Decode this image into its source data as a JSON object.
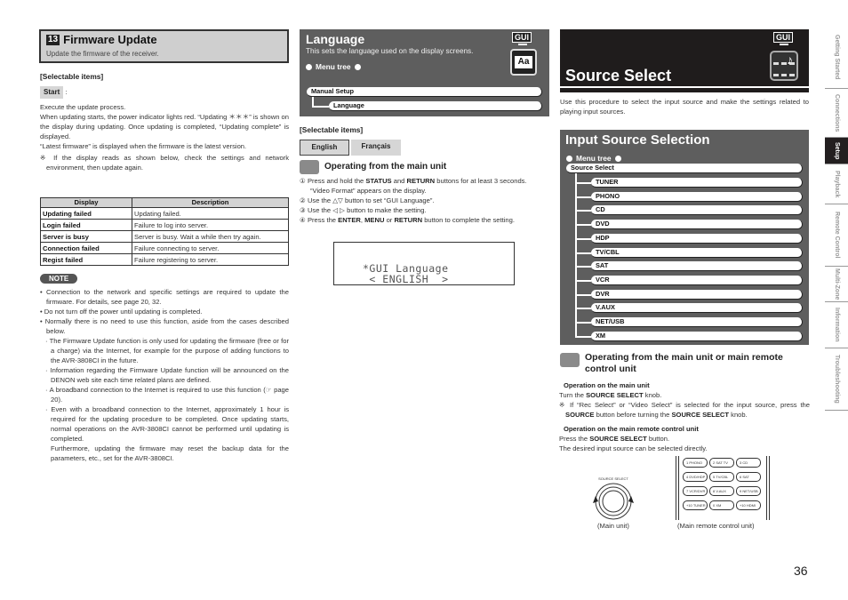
{
  "firmware_update": {
    "number": "13",
    "title": "Firmware Update",
    "subtitle": "Update the firmware of the receiver.",
    "selectable_label": "[Selectable items]",
    "start_chip": "Start",
    "start_colon": ":",
    "execute_text": "Execute the update process.",
    "para1": "When updating starts, the power indicator lights red. “Updating ＊＊＊” is shown on the display during updating. Once updating is completed, “Updating complete” is displayed.",
    "para2": "“Latest firmware” is displayed when the firmware is the latest version.",
    "note_mark": "※ If the display reads as shown below, check the settings and network environment, then update again.",
    "table": {
      "headers": [
        "Display",
        "Description"
      ],
      "rows": [
        [
          "Updating failed",
          "Updating failed."
        ],
        [
          "Login failed",
          "Failure to log into server."
        ],
        [
          "Server is busy",
          "Server is busy. Wait a while then try again."
        ],
        [
          "Connection failed",
          "Failure connecting to server."
        ],
        [
          "Regist failed",
          "Failure registering to server."
        ]
      ]
    },
    "note_label": "NOTE",
    "notes": [
      "• Connection to the network and specific settings are required to update the firmware. For details, see page 20, 32.",
      "• Do not turn off the power until updating is completed.",
      "• Normally there is no need to use this function, aside from the cases described below."
    ],
    "sub_notes": [
      "· The Firmware Update function is only used for updating the firmware (free or for a charge) via the Internet, for example for the purpose of adding functions to the AVR-3808CI in the future.",
      "· Information regarding the Firmware Update function will be announced on the DENON web site each time related plans are defined.",
      "· A broadband connection to the Internet is required to use this function (☞ page 20).",
      "· Even with a broadband connection to the Internet, approximately 1 hour is required for the updating procedure to be completed. Once updating starts, normal operations on the AVR-3808CI cannot be performed until updating is completed."
    ],
    "sub_note_cont": "Furthermore, updating the firmware may reset the backup data for the parameters, etc., set for the AVR-3808CI."
  },
  "language": {
    "title": "Language",
    "description": "This sets the language used on the display screens.",
    "gui_badge": "GUI",
    "menu_tree_label": "Menu tree",
    "tree": [
      "Manual Setup",
      "Language"
    ],
    "selectable_label": "[Selectable items]",
    "options": [
      "English",
      "Français"
    ],
    "operating_heading": "Operating from the main unit",
    "steps": [
      {
        "num": "①",
        "pre": "Press and hold the ",
        "b1": "STATUS",
        "mid": " and ",
        "b2": "RETURN",
        "post": " buttons for at least 3 seconds."
      },
      {
        "num": "②",
        "text": "Use the △▽ button to set “GUI Language”."
      },
      {
        "num": "③",
        "text": "Use the ◁ ▷ button to make the setting."
      },
      {
        "num": "④",
        "pre": "Press the ",
        "b1": "ENTER",
        "mid": ", ",
        "b2": "MENU",
        "mid2": " or ",
        "b3": "RETURN",
        "post": " button to complete the setting."
      }
    ],
    "step1_sub": "“Video Format” appears on the display.",
    "lcd_line1": "*GUI Language",
    "lcd_line2": " < ENGLISH  >"
  },
  "source_select": {
    "title": "Source Select",
    "gui_badge": "GUI",
    "description": "Use this procedure to select the input source and make the settings related to playing input sources.",
    "input_section_title": "Input Source Selection",
    "menu_tree_label": "Menu tree",
    "tree_root": "Source Select",
    "tree_items": [
      "TUNER",
      "PHONO",
      "CD",
      "DVD",
      "HDP",
      "TV/CBL",
      "SAT",
      "VCR",
      "DVR",
      "V.AUX",
      "NET/USB",
      "XM"
    ],
    "operating_heading": "Operating from the main unit or main remote control unit",
    "main_unit_heading": "Operation on the main unit",
    "main_unit_text_pre": "Turn the ",
    "main_unit_text_b": "SOURCE SELECT",
    "main_unit_text_post": " knob.",
    "main_unit_note_pre": "※ If “Rec Select” or “Video Select” is selected for the input source, press the ",
    "main_unit_note_b1": "SOURCE",
    "main_unit_note_mid": " button before turning the ",
    "main_unit_note_b2": "SOURCE SELECT",
    "main_unit_note_post": " knob.",
    "remote_heading": "Operation on the main remote control unit",
    "remote_text_pre": "Press the ",
    "remote_text_b": "SOURCE SELECT",
    "remote_text_post": " button.",
    "remote_text2": "The desired input source can be selected directly.",
    "knob_label": "SOURCE SELECT",
    "caption_main": "(Main unit)",
    "caption_remote": "(Main remote control unit)",
    "remote_keys": [
      [
        "1 PHONO",
        "2 SAT TV",
        "3 CD"
      ],
      [
        "4 DVD/HDP",
        "5 TV/CBL",
        "6 SAT"
      ],
      [
        "7 VCR/DVR",
        "8 V.AUX",
        "9 NET/USB"
      ],
      [
        "+10 TUNER",
        "0 XM",
        "+10 HDMI"
      ]
    ]
  },
  "side_nav": {
    "tabs": [
      "Getting Started",
      "Connections",
      "Setup",
      "Playback",
      "Remote Control",
      "Multi-Zone",
      "Information",
      "Troubleshooting"
    ],
    "active": "Setup"
  },
  "page_number": "36"
}
